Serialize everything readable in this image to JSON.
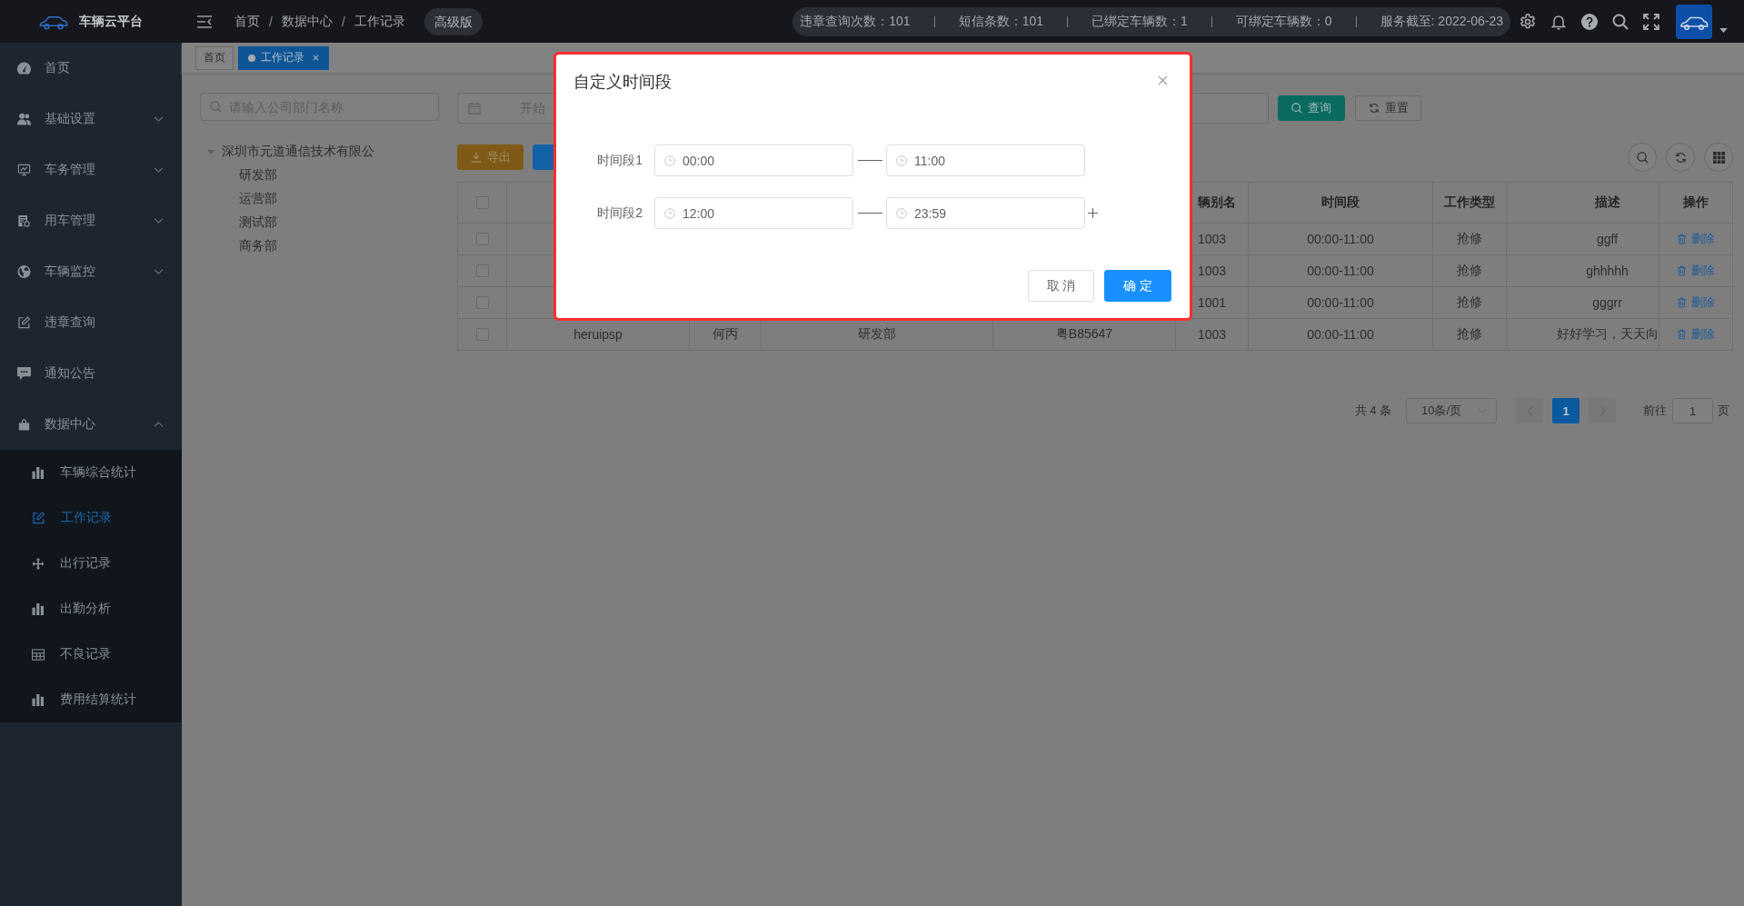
{
  "topbar": {
    "title": "车辆云平台",
    "breadcrumb": [
      {
        "label": "首页",
        "separator": "/"
      },
      {
        "label": "数据中心",
        "separator": "/"
      },
      {
        "label": "工作记录"
      }
    ],
    "edition": "高级版",
    "stats": [
      "违章查询次数：101",
      "短信条数：101",
      "已绑定车辆数：1",
      "可绑定车辆数：0",
      "服务截至: 2022-06-23"
    ]
  },
  "sidebar": {
    "items": [
      {
        "label": "首页",
        "kind": "link"
      },
      {
        "label": "基础设置",
        "kind": "submenu",
        "expanded": false
      },
      {
        "label": "车务管理",
        "kind": "submenu",
        "expanded": false
      },
      {
        "label": "用车管理",
        "kind": "submenu",
        "expanded": false
      },
      {
        "label": "车辆监控",
        "kind": "submenu",
        "expanded": false
      },
      {
        "label": "违章查询",
        "kind": "link"
      },
      {
        "label": "通知公告",
        "kind": "link"
      },
      {
        "label": "数据中心",
        "kind": "submenu",
        "expanded": true,
        "children": [
          {
            "label": "车辆综合统计",
            "selected": false
          },
          {
            "label": "工作记录",
            "selected": true
          },
          {
            "label": "出行记录",
            "selected": false
          },
          {
            "label": "出勤分析",
            "selected": false
          },
          {
            "label": "不良记录",
            "selected": false
          },
          {
            "label": "费用结算统计",
            "selected": false
          }
        ]
      }
    ]
  },
  "tabs": [
    {
      "label": "首页",
      "selected": false,
      "closable": false
    },
    {
      "label": "工作记录",
      "selected": true,
      "closable": true
    }
  ],
  "department_search": {
    "placeholder": "请输入公司部门名称"
  },
  "department_tree": [
    {
      "label": "深圳市元道通信技术有限公",
      "expanded": true,
      "children": [
        {
          "label": "研发部"
        },
        {
          "label": "运营部"
        },
        {
          "label": "测试部"
        },
        {
          "label": "商务部"
        }
      ]
    }
  ],
  "filters": {
    "date_range": {
      "placeholder": "开始"
    },
    "buttons": [
      {
        "kind": "query",
        "label": "查询"
      },
      {
        "kind": "reset",
        "label": "重置"
      }
    ]
  },
  "toolbar": {
    "buttons": [
      {
        "kind": "export",
        "label": "导出"
      },
      {
        "kind": "primary"
      }
    ]
  },
  "table": {
    "select_all": {
      "checked": false
    },
    "columns": [
      "",
      "",
      "",
      "",
      "辆别名",
      "时间段",
      "工作类型",
      "描述",
      "操作"
    ],
    "rows": [
      {
        "checked": false,
        "cells": [
          "",
          "",
          "",
          "",
          "1003",
          "00:00-11:00",
          "抢修",
          "ggff"
        ],
        "action": "删除"
      },
      {
        "checked": false,
        "cells": [
          "",
          "",
          "",
          "",
          "1003",
          "00:00-11:00",
          "抢修",
          "ghhhhh"
        ],
        "action": "删除"
      },
      {
        "checked": false,
        "cells": [
          "",
          "",
          "",
          "",
          "1001",
          "00:00-11:00",
          "抢修",
          "gggrr"
        ],
        "action": "删除"
      },
      {
        "checked": false,
        "cells": [
          "heruipsp",
          "何丙",
          "研发部",
          "粤B85647",
          "1003",
          "00:00-11:00",
          "抢修",
          "好好学习，天天向"
        ],
        "action": "删除"
      }
    ]
  },
  "pagination": {
    "total": "共 4 条",
    "page_size": "10条/页",
    "prev_disabled": true,
    "pages": [
      {
        "label": "1",
        "selected": true
      }
    ],
    "next_disabled": true,
    "goto_label": "前往",
    "goto_value": "1",
    "goto_unit": "页"
  },
  "dialog": {
    "title": "自定义时间段",
    "ranges": [
      {
        "label": "时间段1",
        "start": "00:00",
        "end": "11:00",
        "addable": false
      },
      {
        "label": "时间段2",
        "start": "12:00",
        "end": "23:59",
        "addable": true
      }
    ],
    "buttons": [
      {
        "kind": "default",
        "label": "取 消"
      },
      {
        "kind": "primary",
        "label": "确 定"
      }
    ]
  }
}
